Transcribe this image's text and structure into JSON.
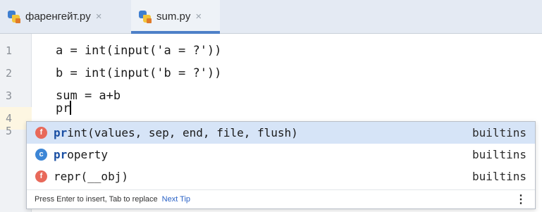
{
  "tabs": [
    {
      "label": "фаренгейт.py",
      "icon": "python-file-icon",
      "close": "×"
    },
    {
      "label": "sum.py",
      "icon": "python-file-icon",
      "close": "×",
      "active": true
    }
  ],
  "editor": {
    "line_numbers": [
      "1",
      "2",
      "3",
      "4",
      "5"
    ],
    "lines": [
      "a = int(input('a = ?'))",
      "b = int(input('b = ?'))",
      "sum = a+b",
      "pr"
    ],
    "current_line_highlight": "#fdf6e2"
  },
  "completion": {
    "items": [
      {
        "kind": "f",
        "kind_icon": "function-icon",
        "match": "pr",
        "rest": "int(values, sep, end, file, flush)",
        "source": "builtins",
        "selected": true
      },
      {
        "kind": "c",
        "kind_icon": "class-icon",
        "match": "pr",
        "rest": "operty",
        "source": "builtins"
      },
      {
        "kind": "f",
        "kind_icon": "function-icon",
        "match": "",
        "rest": "repr(__obj)",
        "source": "builtins"
      }
    ],
    "hint": "Press Enter to insert, Tab to replace",
    "next_tip": "Next Tip",
    "menu": "⋮"
  },
  "colors": {
    "tab_accent": "#4e80c8",
    "selection": "#d6e4f7",
    "function_badge": "#e8695a",
    "class_badge": "#3d86d6"
  }
}
